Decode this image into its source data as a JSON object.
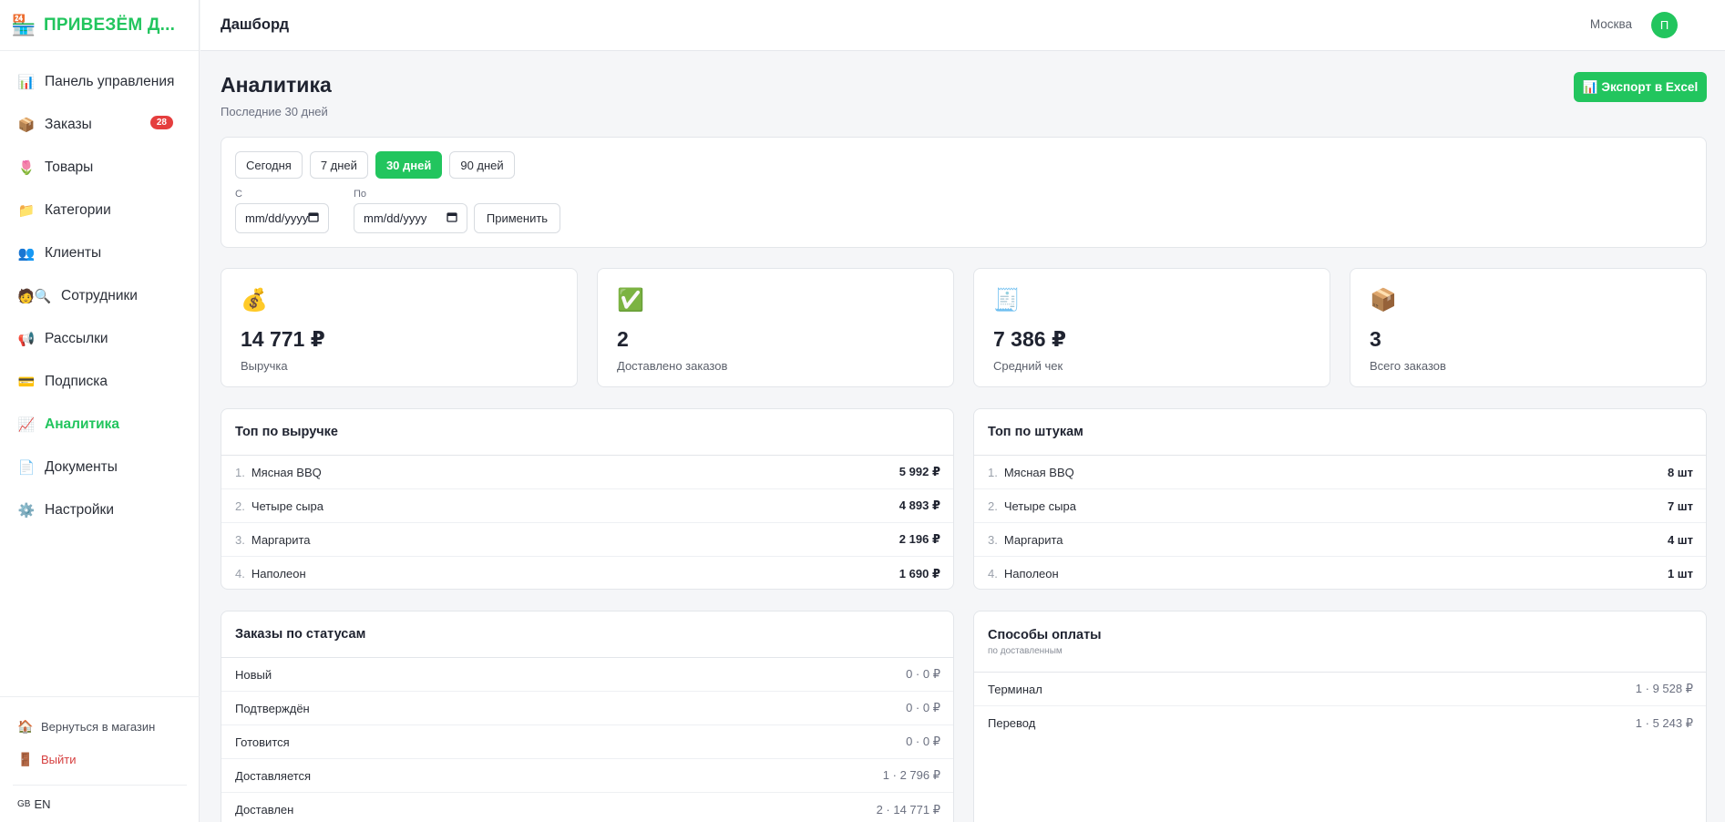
{
  "brand": {
    "name": "ПРИВЕЗЁМ Д...",
    "logo_icon": "🏪"
  },
  "sidebar": {
    "items": [
      {
        "label": "Панель управления",
        "icon": "📊",
        "name": "sidebar-item-dashboard"
      },
      {
        "label": "Заказы",
        "icon": "📦",
        "name": "sidebar-item-orders",
        "badge": "28"
      },
      {
        "label": "Товары",
        "icon": "🌷",
        "name": "sidebar-item-products"
      },
      {
        "label": "Категории",
        "icon": "📁",
        "name": "sidebar-item-categories"
      },
      {
        "label": "Клиенты",
        "icon": "👥",
        "name": "sidebar-item-clients"
      },
      {
        "label": "Сотрудники",
        "icon": "🧑🔍",
        "name": "sidebar-item-employees"
      },
      {
        "label": "Рассылки",
        "icon": "📢",
        "name": "sidebar-item-mailings"
      },
      {
        "label": "Подписка",
        "icon": "💳",
        "name": "sidebar-item-subscription"
      },
      {
        "label": "Аналитика",
        "icon": "📈",
        "name": "sidebar-item-analytics",
        "active": true
      },
      {
        "label": "Документы",
        "icon": "📄",
        "name": "sidebar-item-documents"
      },
      {
        "label": "Настройки",
        "icon": "⚙️",
        "name": "sidebar-item-settings"
      }
    ],
    "back_to_store": "Вернуться в магазин",
    "back_icon": "🏠",
    "logout": "Выйти",
    "logout_icon": "🚪",
    "lang_flag": "GB",
    "lang": "EN"
  },
  "topbar": {
    "title": "Дашборд",
    "city": "Москва",
    "avatar_letter": "П"
  },
  "page": {
    "title": "Аналитика",
    "subtitle": "Последние 30 дней",
    "export_label": "📊 Экспорт в Excel"
  },
  "filters": {
    "periods": [
      "Сегодня",
      "7 дней",
      "30 дней",
      "90 дней"
    ],
    "active_period": "30 дней",
    "from_label": "С",
    "to_label": "По",
    "from_placeholder": "mm/dd/yyyy",
    "to_placeholder": "mm/dd/yyyy",
    "apply_label": "Применить"
  },
  "stats": [
    {
      "icon": "💰",
      "value": "14 771 ₽",
      "label": "Выручка"
    },
    {
      "icon": "✅",
      "value": "2",
      "label": "Доставлено заказов"
    },
    {
      "icon": "🧾",
      "value": "7 386 ₽",
      "label": "Средний чек"
    },
    {
      "icon": "📦",
      "value": "3",
      "label": "Всего заказов"
    }
  ],
  "top_revenue": {
    "title": "Топ по выручке",
    "rows": [
      {
        "num": "1.",
        "name": "Мясная BBQ",
        "value": "5 992 ₽"
      },
      {
        "num": "2.",
        "name": "Четыре сыра",
        "value": "4 893 ₽"
      },
      {
        "num": "3.",
        "name": "Маргарита",
        "value": "2 196 ₽"
      },
      {
        "num": "4.",
        "name": "Наполеон",
        "value": "1 690 ₽"
      }
    ]
  },
  "top_units": {
    "title": "Топ по штукам",
    "rows": [
      {
        "num": "1.",
        "name": "Мясная BBQ",
        "value": "8 шт"
      },
      {
        "num": "2.",
        "name": "Четыре сыра",
        "value": "7 шт"
      },
      {
        "num": "3.",
        "name": "Маргарита",
        "value": "4 шт"
      },
      {
        "num": "4.",
        "name": "Наполеон",
        "value": "1 шт"
      }
    ]
  },
  "orders_by_status": {
    "title": "Заказы по статусам",
    "rows": [
      {
        "name": "Новый",
        "value": "0 · 0 ₽"
      },
      {
        "name": "Подтверждён",
        "value": "0 · 0 ₽"
      },
      {
        "name": "Готовится",
        "value": "0 · 0 ₽"
      },
      {
        "name": "Доставляется",
        "value": "1 · 2 796 ₽"
      },
      {
        "name": "Доставлен",
        "value": "2 · 14 771 ₽"
      }
    ]
  },
  "payment_methods": {
    "title": "Способы оплаты",
    "subtitle": "по доставленным",
    "rows": [
      {
        "name": "Терминал",
        "value": "1 · 9 528 ₽"
      },
      {
        "name": "Перевод",
        "value": "1 · 5 243 ₽"
      }
    ]
  }
}
